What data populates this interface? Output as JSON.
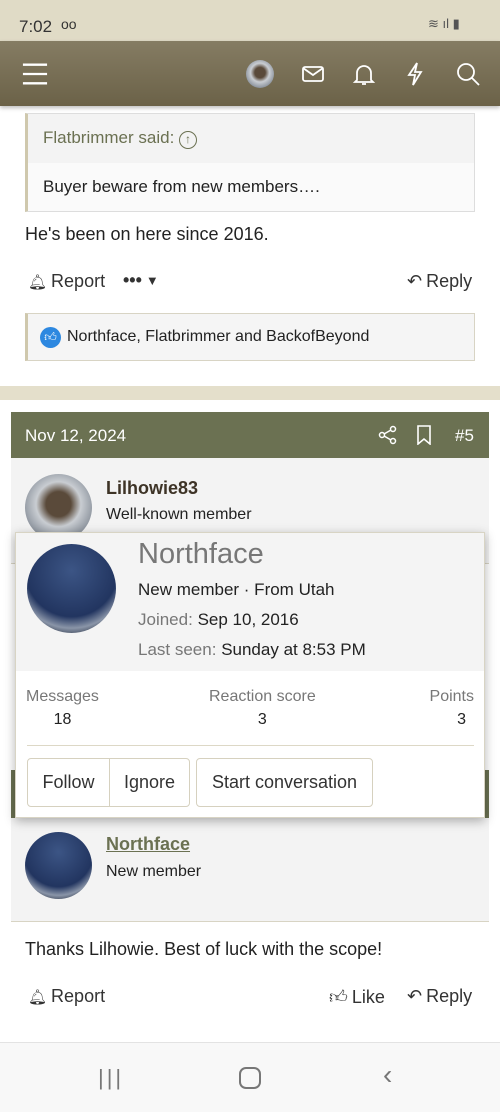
{
  "status": {
    "time": "7:02"
  },
  "header": {
    "icons": [
      "menu-icon",
      "avatar",
      "envelope-icon",
      "bell-icon",
      "bolt-icon",
      "search-icon"
    ]
  },
  "post4": {
    "quote_author": "Flatbrimmer said:",
    "quote_text": "Buyer beware from new members….",
    "body": "He's been on here since 2016.",
    "report": "Report",
    "reply": "Reply",
    "reactions": "Northface, Flatbrimmer and BackofBeyond"
  },
  "post5": {
    "date": "Nov 12, 2024",
    "number": "#5",
    "username": "Lilhowie83",
    "user_title": "Well-known member"
  },
  "popup": {
    "name": "Northface",
    "subtitle": "New member · From Utah",
    "joined_label": "Joined:",
    "joined": "Sep 10, 2016",
    "last_seen_label": "Last seen:",
    "last_seen": "Sunday at 8:53 PM",
    "stats": [
      {
        "label": "Messages",
        "value": "18"
      },
      {
        "label": "Reaction score",
        "value": "3"
      },
      {
        "label": "Points",
        "value": "3"
      }
    ],
    "follow": "Follow",
    "ignore": "Ignore",
    "start": "Start conversation"
  },
  "post6": {
    "username": "Northface",
    "user_title": "New member",
    "body": "Thanks Lilhowie. Best of luck with the scope!",
    "report": "Report",
    "like": "Like",
    "reply": "Reply"
  },
  "colors": {
    "header": "#766d54",
    "post_header": "#6b7152",
    "accent": "#6b7152"
  }
}
